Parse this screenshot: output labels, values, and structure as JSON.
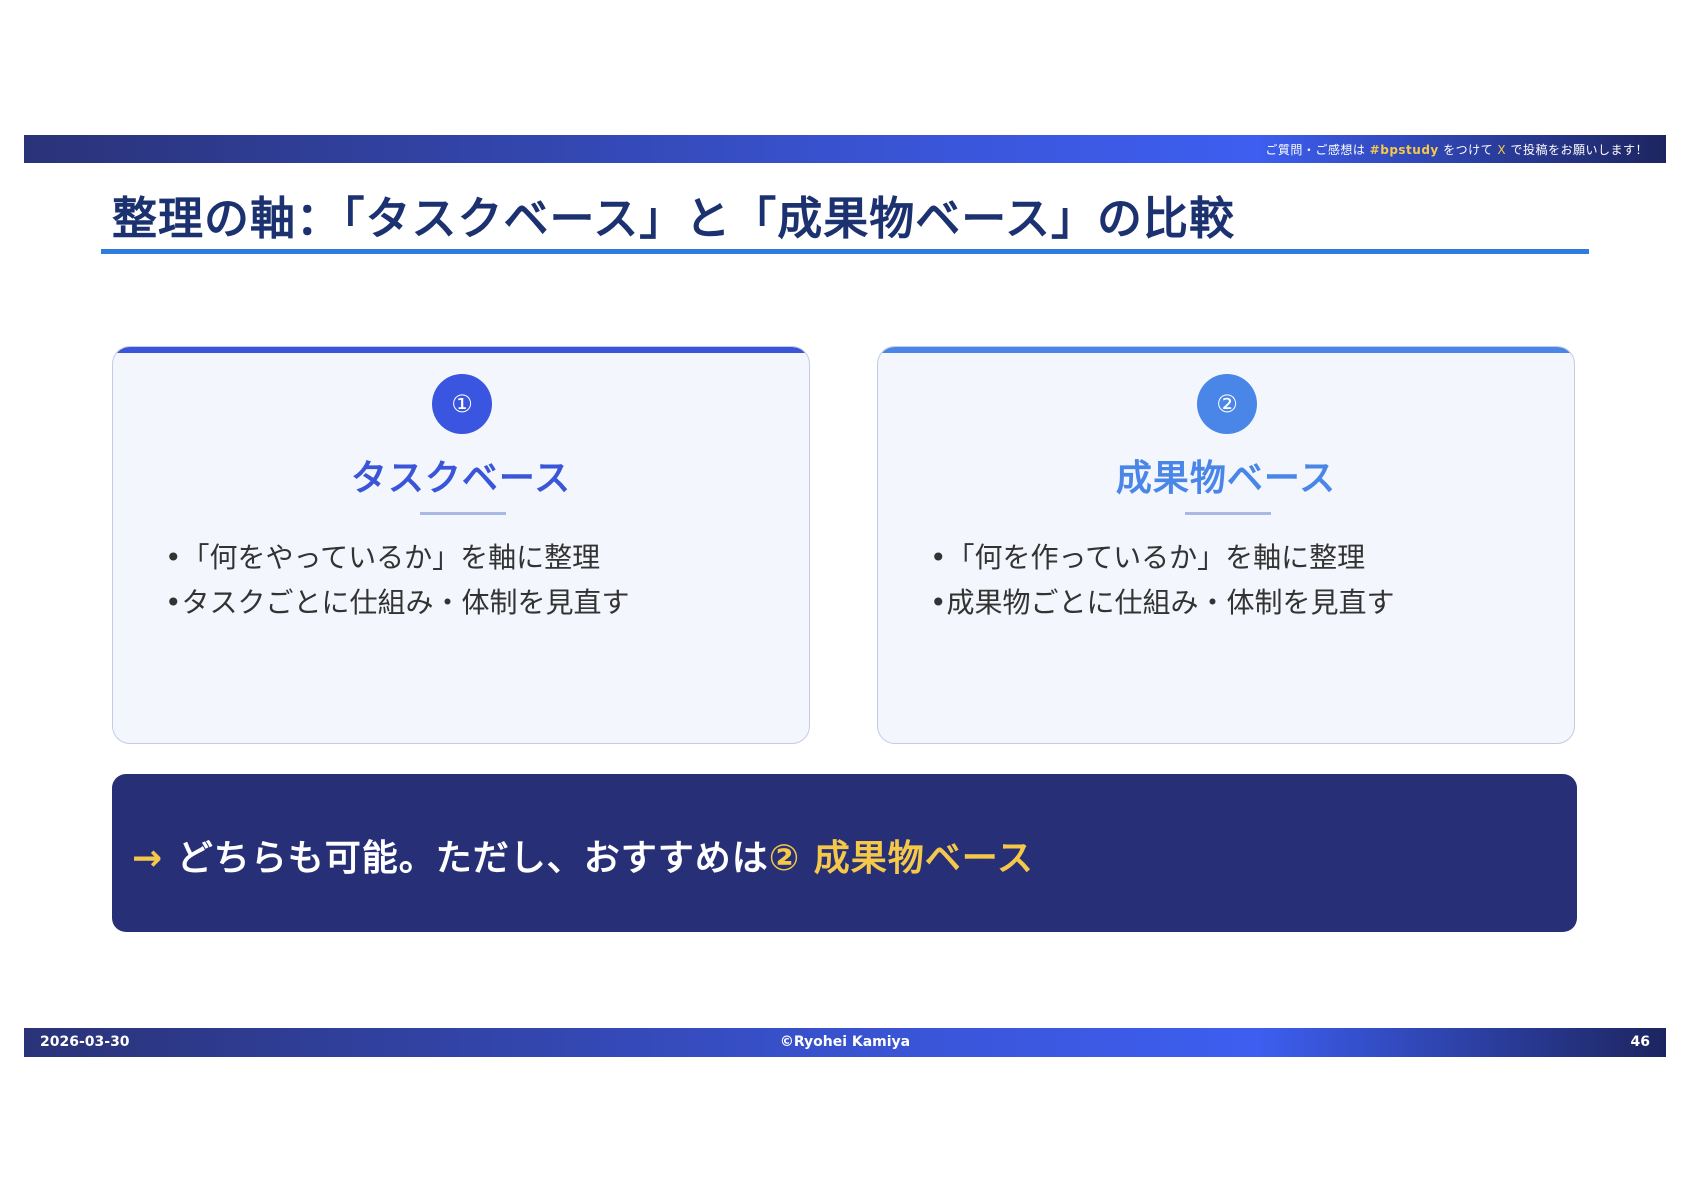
{
  "header": {
    "note_prefix": "ご質問・ご感想は",
    "note_hashtag": "#bpstudy",
    "note_mid": "をつけて",
    "note_x": "X",
    "note_suffix": "で投稿をお願いします！"
  },
  "title": "整理の軸：「タスクベース」と「成果物ベース」の比較",
  "cards": [
    {
      "badge": "①",
      "title": "タスクベース",
      "bullets": [
        "•「何をやっているか」を軸に整理",
        "•タスクごとに仕組み・体制を見直す"
      ]
    },
    {
      "badge": "②",
      "title": "成果物ベース",
      "bullets": [
        "•「何を作っているか」を軸に整理",
        "•成果物ごとに仕組み・体制を見直す"
      ]
    }
  ],
  "conclusion": {
    "arrow": "→",
    "text": " どちらも可能。ただし、おすすめは",
    "highlight": "② 成果物ベース"
  },
  "footer": {
    "date": "2026-03-30",
    "copyright": "©Ryohei Kamiya",
    "page": "46"
  },
  "colors": {
    "title": "#1c3270",
    "accent_blue": "#3a55d8",
    "accent_light_blue": "#4a86e8",
    "conclusion_bg": "#273076",
    "highlight": "#f5c84a"
  }
}
